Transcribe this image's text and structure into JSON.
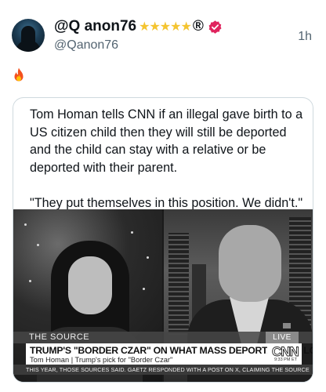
{
  "post": {
    "display_name": "@Q anon76",
    "stars": "★★★★★",
    "reg_mark": "®",
    "handle": "@Qanon76",
    "timestamp": "1h",
    "body_emoji": "🔥"
  },
  "quote": {
    "paragraph_1": "Tom Homan tells CNN if an illegal gave birth to a US citizen child then they will still be deported and the child can stay with a relative or be deported with their parent.",
    "paragraph_2": "\"They put themselves in this position. We didn't.\""
  },
  "video": {
    "show_name": "THE SOURCE",
    "live_label": "LIVE",
    "headline": "TRUMP'S \"BORDER CZAR\" ON WHAT MASS DEPORTATIONS LOOK LIKE",
    "subline": "Tom Homan  |  Trump's pick for \"Border Czar\"",
    "network_logo": "CNN",
    "time_badge": "9:33 PM ET",
    "ticker": "THIS YEAR, THOSE SOURCES SAID. GAETZ RESPONDED WITH A POST ON X, CLAIMING  THE SOURCE"
  },
  "colors": {
    "verified_badge": "#e0245e",
    "stars": "#f4c430",
    "secondary_text": "#536471",
    "card_border": "#cfd9de"
  },
  "icons": {
    "verified": "verified-badge-icon",
    "fire": "fire-icon"
  }
}
